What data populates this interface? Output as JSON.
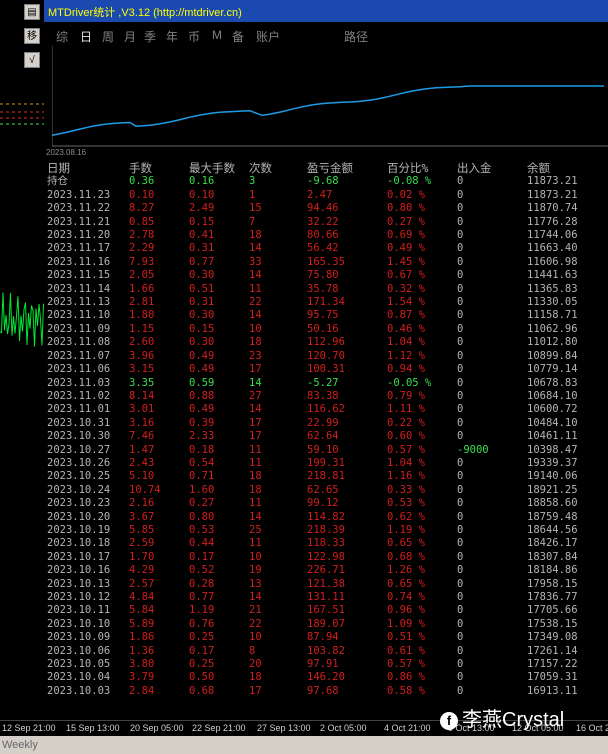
{
  "title": "MTDriver统计 ,V3.12 (http://mtdriver.cn)",
  "side_buttons": [
    "▤",
    "移",
    "√"
  ],
  "tabs": [
    "综",
    "日",
    "周",
    "月",
    "季",
    "年",
    "币",
    "M",
    "备",
    "账户",
    "路径"
  ],
  "active_tab": "日",
  "chart_start_label": "2023.08.16",
  "headers": [
    "日期",
    "手数",
    "最大手数",
    "次数",
    "盈亏金额",
    "百分比%",
    "出入金",
    "余额"
  ],
  "rows": [
    {
      "date": "持仓",
      "lots": "0.36",
      "maxlots": "0.16",
      "count": "3",
      "pnl": "-9.68",
      "pct": "-0.08 %",
      "flow": "0",
      "bal": "11873.21",
      "tone": "pos"
    },
    {
      "date": "2023.11.23",
      "lots": "0.10",
      "maxlots": "0.10",
      "count": "1",
      "pnl": "2.47",
      "pct": "0.02 %",
      "flow": "0",
      "bal": "11873.21",
      "tone": "neg"
    },
    {
      "date": "2023.11.22",
      "lots": "8.27",
      "maxlots": "2.49",
      "count": "15",
      "pnl": "94.46",
      "pct": "0.80 %",
      "flow": "0",
      "bal": "11870.74",
      "tone": "neg"
    },
    {
      "date": "2023.11.21",
      "lots": "0.85",
      "maxlots": "0.15",
      "count": "7",
      "pnl": "32.22",
      "pct": "0.27 %",
      "flow": "0",
      "bal": "11776.28",
      "tone": "neg"
    },
    {
      "date": "2023.11.20",
      "lots": "2.78",
      "maxlots": "0.41",
      "count": "18",
      "pnl": "80.66",
      "pct": "0.69 %",
      "flow": "0",
      "bal": "11744.06",
      "tone": "neg"
    },
    {
      "date": "2023.11.17",
      "lots": "2.29",
      "maxlots": "0.31",
      "count": "14",
      "pnl": "56.42",
      "pct": "0.49 %",
      "flow": "0",
      "bal": "11663.40",
      "tone": "neg"
    },
    {
      "date": "2023.11.16",
      "lots": "7.93",
      "maxlots": "0.77",
      "count": "33",
      "pnl": "165.35",
      "pct": "1.45 %",
      "flow": "0",
      "bal": "11606.98",
      "tone": "neg"
    },
    {
      "date": "2023.11.15",
      "lots": "2.05",
      "maxlots": "0.30",
      "count": "14",
      "pnl": "75.80",
      "pct": "0.67 %",
      "flow": "0",
      "bal": "11441.63",
      "tone": "neg"
    },
    {
      "date": "2023.11.14",
      "lots": "1.66",
      "maxlots": "0.51",
      "count": "11",
      "pnl": "35.78",
      "pct": "0.32 %",
      "flow": "0",
      "bal": "11365.83",
      "tone": "neg"
    },
    {
      "date": "2023.11.13",
      "lots": "2.81",
      "maxlots": "0.31",
      "count": "22",
      "pnl": "171.34",
      "pct": "1.54 %",
      "flow": "0",
      "bal": "11330.05",
      "tone": "neg"
    },
    {
      "date": "2023.11.10",
      "lots": "1.80",
      "maxlots": "0.30",
      "count": "14",
      "pnl": "95.75",
      "pct": "0.87 %",
      "flow": "0",
      "bal": "11158.71",
      "tone": "neg"
    },
    {
      "date": "2023.11.09",
      "lots": "1.15",
      "maxlots": "0.15",
      "count": "10",
      "pnl": "50.16",
      "pct": "0.46 %",
      "flow": "0",
      "bal": "11062.96",
      "tone": "neg"
    },
    {
      "date": "2023.11.08",
      "lots": "2.60",
      "maxlots": "0.30",
      "count": "18",
      "pnl": "112.96",
      "pct": "1.04 %",
      "flow": "0",
      "bal": "11012.80",
      "tone": "neg"
    },
    {
      "date": "2023.11.07",
      "lots": "3.96",
      "maxlots": "0.49",
      "count": "23",
      "pnl": "120.70",
      "pct": "1.12 %",
      "flow": "0",
      "bal": "10899.84",
      "tone": "neg"
    },
    {
      "date": "2023.11.06",
      "lots": "3.15",
      "maxlots": "0.49",
      "count": "17",
      "pnl": "100.31",
      "pct": "0.94 %",
      "flow": "0",
      "bal": "10779.14",
      "tone": "neg"
    },
    {
      "date": "2023.11.03",
      "lots": "3.35",
      "maxlots": "0.59",
      "count": "14",
      "pnl": "-5.27",
      "pct": "-0.05 %",
      "flow": "0",
      "bal": "10678.83",
      "tone": "pos"
    },
    {
      "date": "2023.11.02",
      "lots": "8.14",
      "maxlots": "0.88",
      "count": "27",
      "pnl": "83.38",
      "pct": "0.79 %",
      "flow": "0",
      "bal": "10684.10",
      "tone": "neg"
    },
    {
      "date": "2023.11.01",
      "lots": "3.01",
      "maxlots": "0.49",
      "count": "14",
      "pnl": "116.62",
      "pct": "1.11 %",
      "flow": "0",
      "bal": "10600.72",
      "tone": "neg"
    },
    {
      "date": "2023.10.31",
      "lots": "3.16",
      "maxlots": "0.39",
      "count": "17",
      "pnl": "22.99",
      "pct": "0.22 %",
      "flow": "0",
      "bal": "10484.10",
      "tone": "neg"
    },
    {
      "date": "2023.10.30",
      "lots": "7.46",
      "maxlots": "2.33",
      "count": "17",
      "pnl": "62.64",
      "pct": "0.60 %",
      "flow": "0",
      "bal": "10461.11",
      "tone": "neg"
    },
    {
      "date": "2023.10.27",
      "lots": "1.47",
      "maxlots": "0.18",
      "count": "11",
      "pnl": "59.10",
      "pct": "0.57 %",
      "flow": "-9000",
      "bal": "10398.47",
      "tone": "neg",
      "flow_tone": "dep"
    },
    {
      "date": "2023.10.26",
      "lots": "2.43",
      "maxlots": "0.54",
      "count": "11",
      "pnl": "199.31",
      "pct": "1.04 %",
      "flow": "0",
      "bal": "19339.37",
      "tone": "neg"
    },
    {
      "date": "2023.10.25",
      "lots": "5.10",
      "maxlots": "0.71",
      "count": "18",
      "pnl": "218.81",
      "pct": "1.16 %",
      "flow": "0",
      "bal": "19140.06",
      "tone": "neg"
    },
    {
      "date": "2023.10.24",
      "lots": "10.74",
      "maxlots": "1.60",
      "count": "18",
      "pnl": "62.65",
      "pct": "0.33 %",
      "flow": "0",
      "bal": "18921.25",
      "tone": "neg"
    },
    {
      "date": "2023.10.23",
      "lots": "2.16",
      "maxlots": "0.27",
      "count": "11",
      "pnl": "99.12",
      "pct": "0.53 %",
      "flow": "0",
      "bal": "18858.60",
      "tone": "neg"
    },
    {
      "date": "2023.10.20",
      "lots": "3.67",
      "maxlots": "0.80",
      "count": "14",
      "pnl": "114.82",
      "pct": "0.62 %",
      "flow": "0",
      "bal": "18759.48",
      "tone": "neg"
    },
    {
      "date": "2023.10.19",
      "lots": "5.85",
      "maxlots": "0.53",
      "count": "25",
      "pnl": "218.39",
      "pct": "1.19 %",
      "flow": "0",
      "bal": "18644.56",
      "tone": "neg"
    },
    {
      "date": "2023.10.18",
      "lots": "2.59",
      "maxlots": "0.44",
      "count": "11",
      "pnl": "118.33",
      "pct": "0.65 %",
      "flow": "0",
      "bal": "18426.17",
      "tone": "neg"
    },
    {
      "date": "2023.10.17",
      "lots": "1.70",
      "maxlots": "0.17",
      "count": "10",
      "pnl": "122.98",
      "pct": "0.68 %",
      "flow": "0",
      "bal": "18307.84",
      "tone": "neg"
    },
    {
      "date": "2023.10.16",
      "lots": "4.29",
      "maxlots": "0.52",
      "count": "19",
      "pnl": "226.71",
      "pct": "1.26 %",
      "flow": "0",
      "bal": "18184.86",
      "tone": "neg"
    },
    {
      "date": "2023.10.13",
      "lots": "2.57",
      "maxlots": "0.28",
      "count": "13",
      "pnl": "121.38",
      "pct": "0.65 %",
      "flow": "0",
      "bal": "17958.15",
      "tone": "neg"
    },
    {
      "date": "2023.10.12",
      "lots": "4.84",
      "maxlots": "0.77",
      "count": "14",
      "pnl": "131.11",
      "pct": "0.74 %",
      "flow": "0",
      "bal": "17836.77",
      "tone": "neg"
    },
    {
      "date": "2023.10.11",
      "lots": "5.84",
      "maxlots": "1.19",
      "count": "21",
      "pnl": "167.51",
      "pct": "0.96 %",
      "flow": "0",
      "bal": "17705.66",
      "tone": "neg"
    },
    {
      "date": "2023.10.10",
      "lots": "5.89",
      "maxlots": "0.76",
      "count": "22",
      "pnl": "189.07",
      "pct": "1.09 %",
      "flow": "0",
      "bal": "17538.15",
      "tone": "neg"
    },
    {
      "date": "2023.10.09",
      "lots": "1.86",
      "maxlots": "0.25",
      "count": "10",
      "pnl": "87.94",
      "pct": "0.51 %",
      "flow": "0",
      "bal": "17349.08",
      "tone": "neg"
    },
    {
      "date": "2023.10.06",
      "lots": "1.36",
      "maxlots": "0.17",
      "count": "8",
      "pnl": "103.82",
      "pct": "0.61 %",
      "flow": "0",
      "bal": "17261.14",
      "tone": "neg"
    },
    {
      "date": "2023.10.05",
      "lots": "3.80",
      "maxlots": "0.25",
      "count": "20",
      "pnl": "97.91",
      "pct": "0.57 %",
      "flow": "0",
      "bal": "17157.22",
      "tone": "neg"
    },
    {
      "date": "2023.10.04",
      "lots": "3.79",
      "maxlots": "0.50",
      "count": "18",
      "pnl": "146.20",
      "pct": "0.86 %",
      "flow": "0",
      "bal": "17059.31",
      "tone": "neg"
    },
    {
      "date": "2023.10.03",
      "lots": "2.84",
      "maxlots": "0.68",
      "count": "17",
      "pnl": "97.68",
      "pct": "0.58 %",
      "flow": "0",
      "bal": "16913.11",
      "tone": "neg"
    }
  ],
  "axis_labels": [
    "12 Sep 21:00",
    "15 Sep 13:00",
    "20 Sep 05:00",
    "22 Sep 21:00",
    "27 Sep 13:00",
    "2 Oct 05:00",
    "4 Oct 21:00",
    "9 Oct 13:00",
    "12 Oct 05:00",
    "16 Oct 2"
  ],
  "status_tab": "Weekly",
  "watermark": "李燕Crystal",
  "colors": {
    "loss": "#d21e1e",
    "profit": "#3cdc50",
    "curve": "#1e9be6",
    "title_bg": "#1a4ab0",
    "title_text": "#ffff00"
  }
}
